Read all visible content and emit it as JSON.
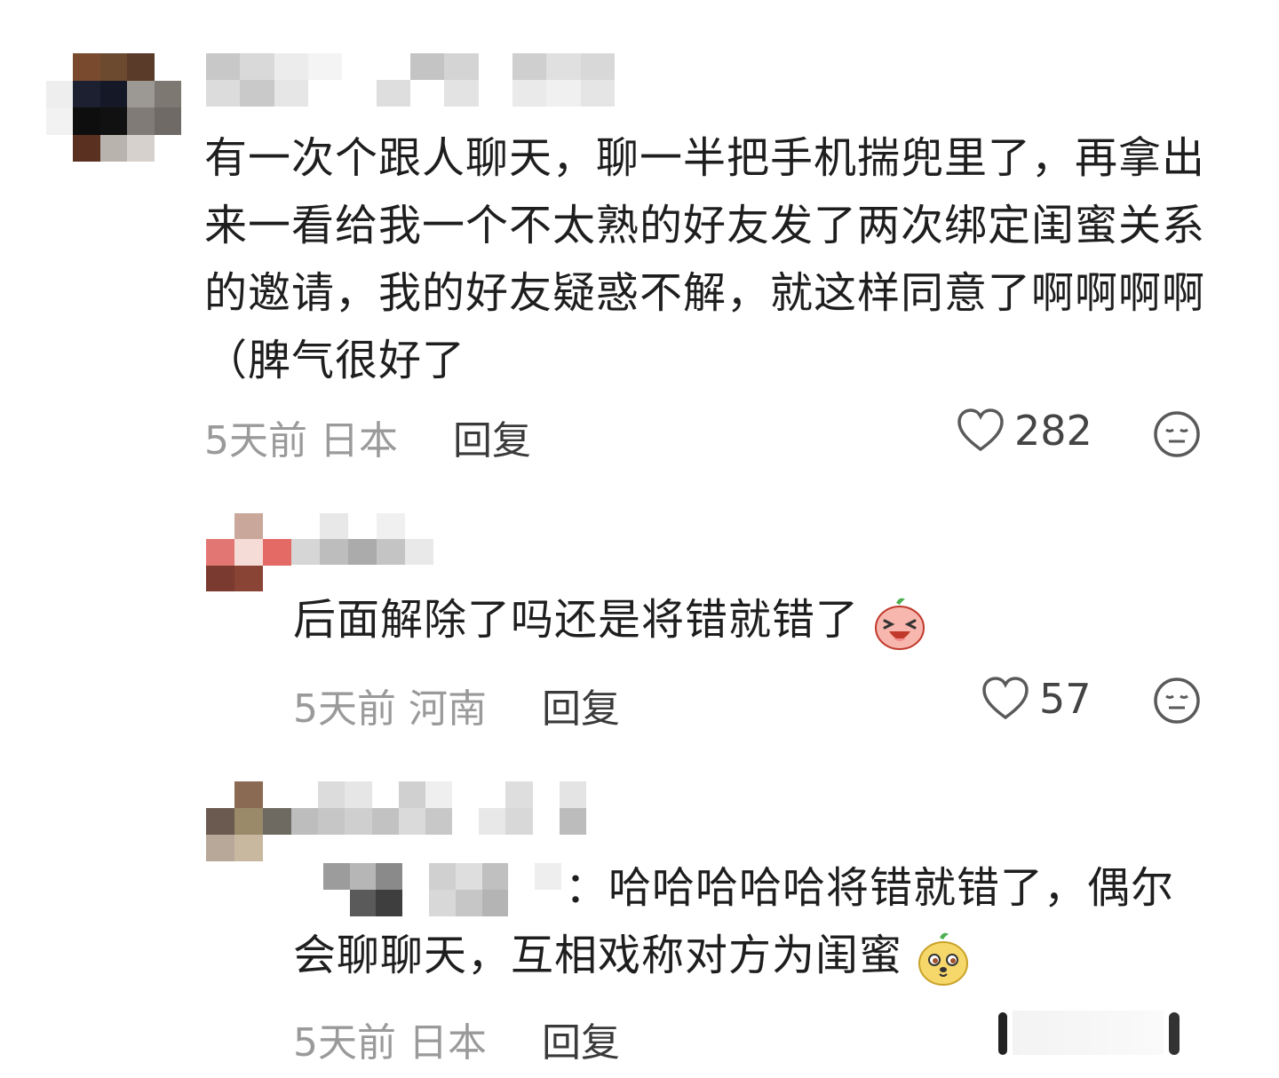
{
  "comments": [
    {
      "text": "有一次个跟人聊天，聊一半把手机揣兜里了，再拿出来一看给我一个不太熟的好友发了两次绑定闺蜜关系的邀请，我的好友疑惑不解，就这样同意了啊啊啊啊（脾气很好了",
      "time": "5天前",
      "location": "日本",
      "reply_label": "回复",
      "likes": "282"
    },
    {
      "text": "后面解除了吗还是将错就错了",
      "time": "5天前",
      "location": "河南",
      "reply_label": "回复",
      "likes": "57",
      "emoji": "laughing-peach-emoji"
    },
    {
      "colon": "：",
      "text": "哈哈哈哈哈将错就错了，偶尔会聊聊天，互相戏称对方为闺蜜",
      "time": "5天前",
      "location": "日本",
      "reply_label": "回复",
      "emoji": "shy-yellow-emoji"
    }
  ],
  "icons": {
    "like": "heart-outline-icon",
    "dislike": "meh-face-icon"
  },
  "colors": {
    "text": "#1e1e1e",
    "meta": "#9a9a9a",
    "reply": "#3a3a3a"
  }
}
